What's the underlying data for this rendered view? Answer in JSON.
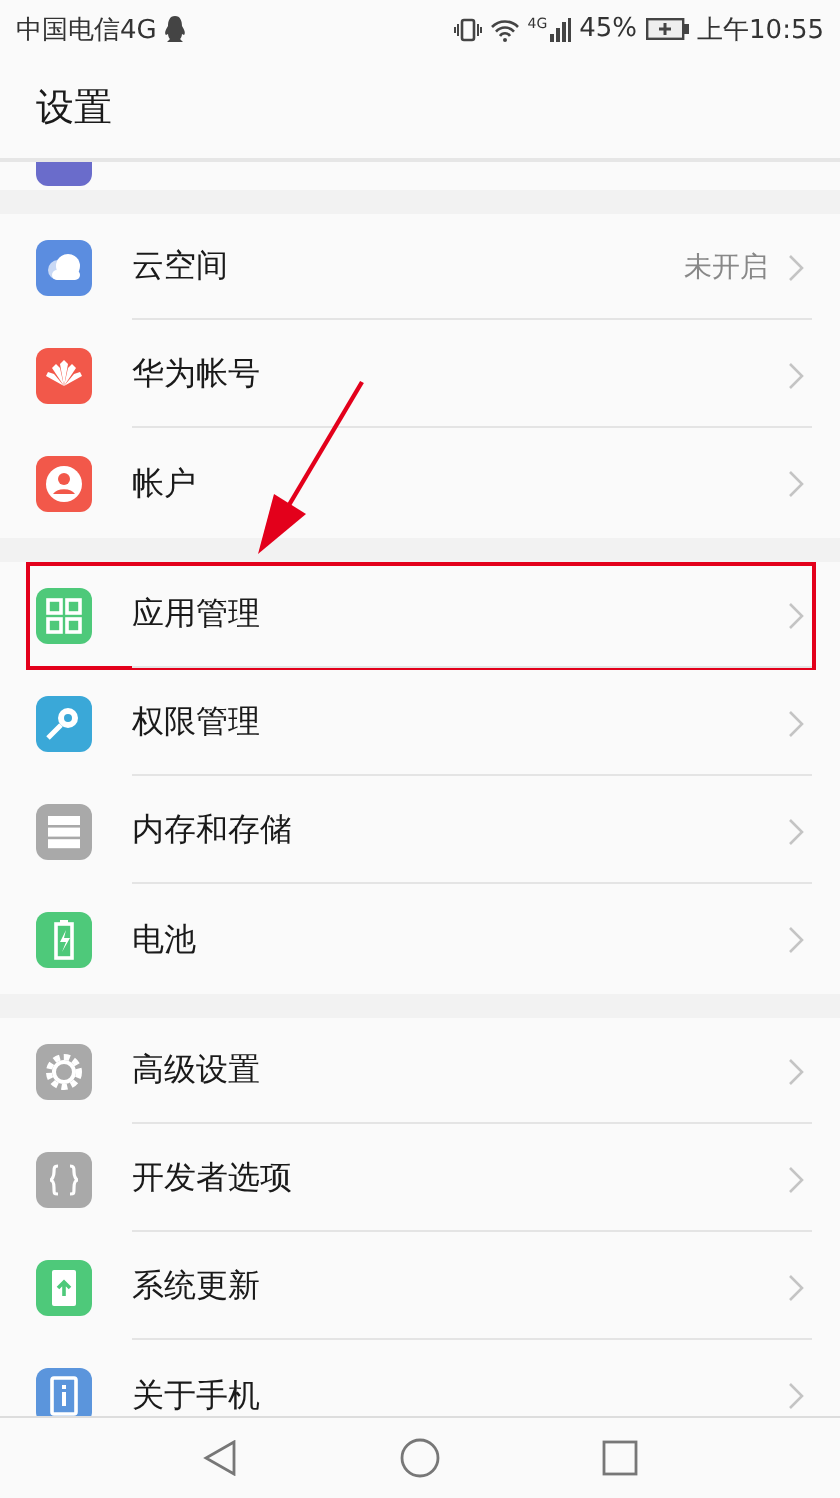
{
  "status_bar": {
    "carrier": "中国电信4G",
    "network_badge": "4G",
    "battery_percent": "45%",
    "time": "上午10:55"
  },
  "title": "设置",
  "groups": [
    {
      "items": [
        {
          "kind": "cloud",
          "label": "云空间",
          "value": "未开启",
          "highlighted": false
        },
        {
          "kind": "petals",
          "label": "华为帐号",
          "highlighted": false
        },
        {
          "kind": "person",
          "label": "帐户",
          "highlighted": false
        }
      ]
    },
    {
      "items": [
        {
          "kind": "apps",
          "label": "应用管理",
          "highlighted": true
        },
        {
          "kind": "key",
          "label": "权限管理",
          "highlighted": false
        },
        {
          "kind": "storage",
          "label": "内存和存储",
          "highlighted": false
        },
        {
          "kind": "battery",
          "label": "电池",
          "highlighted": false
        }
      ]
    },
    {
      "items": [
        {
          "kind": "gear",
          "label": "高级设置",
          "highlighted": false
        },
        {
          "kind": "braces",
          "label": "开发者选项",
          "highlighted": false
        },
        {
          "kind": "update",
          "label": "系统更新",
          "highlighted": false
        },
        {
          "kind": "info",
          "label": "关于手机",
          "highlighted": false
        }
      ]
    }
  ]
}
